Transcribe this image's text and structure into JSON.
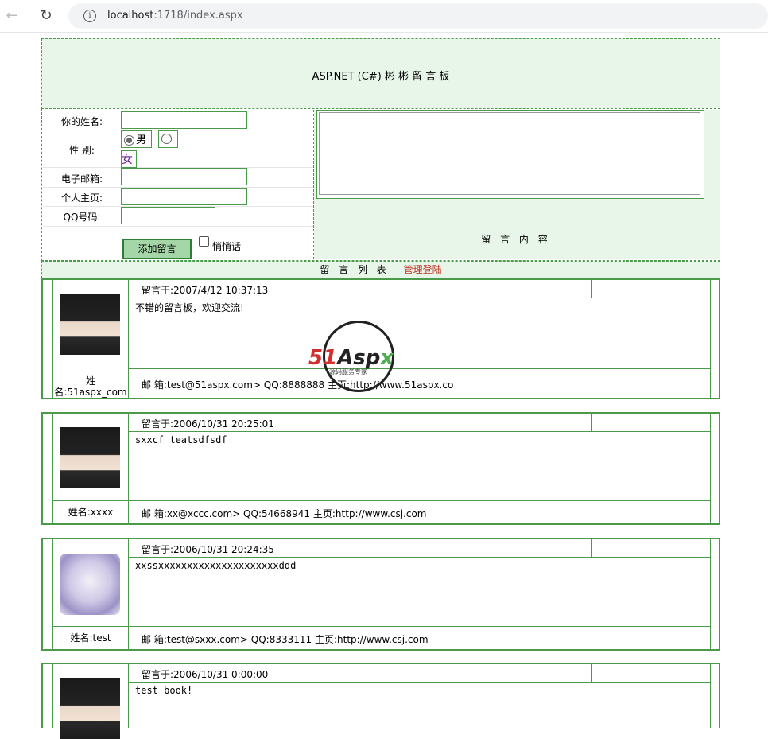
{
  "browser": {
    "url_host": "localhost",
    "url_rest": ":1718/index.aspx"
  },
  "header": {
    "title": "ASP.NET (C#) 彬 彬 留 言 板"
  },
  "form": {
    "name_label": "你的姓名:",
    "gender_label": "性 别:",
    "gender_male": "男",
    "gender_female": "女",
    "email_label": "电子邮箱:",
    "homepage_label": "个人主页:",
    "qq_label": "QQ号码:",
    "submit_label": "添加留言",
    "whisper_label": "悄悄话",
    "content_label": "留 言 内 容"
  },
  "list_bar": {
    "title": "留 言 列 表",
    "admin_login": "管理登陆"
  },
  "messages": [
    {
      "date": "留言于:2007/4/12 10:37:13",
      "body": "不错的留言板，欢迎交流!",
      "name": "姓名:51aspx_com",
      "contact": "邮 箱:test@51aspx.com>     QQ:8888888     主页:http://www.51aspx.co"
    },
    {
      "date": "留言于:2006/10/31 20:25:01",
      "body": "sxxcf teatsdfsdf",
      "name": "姓名:xxxx",
      "contact": "邮 箱:xx@xccc.com>     QQ:54668941     主页:http://www.csj.com"
    },
    {
      "date": "留言于:2006/10/31 20:24:35",
      "body": "xxssxxxxxxxxxxxxxxxxxxxxxddd",
      "name": "姓名:test",
      "contact": "邮 箱:test@sxxx.com>     QQ:8333111     主页:http://www.csj.com"
    },
    {
      "date": "留言于:2006/10/31 0:00:00",
      "body": "test book!"
    }
  ],
  "watermark": {
    "brand_51": "51",
    "brand_asp": "Asp",
    "brand_x": "x",
    "subtitle": "源码服务专家"
  }
}
